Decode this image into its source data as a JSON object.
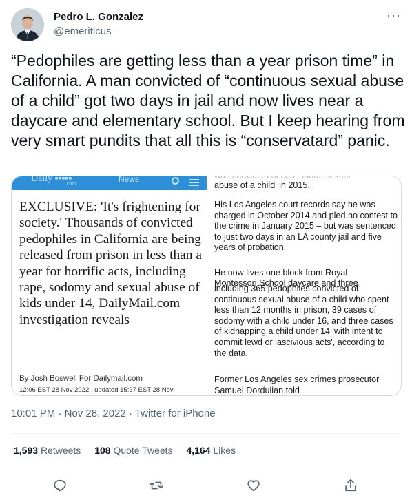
{
  "author": {
    "name": "Pedro L. Gonzalez",
    "handle": "@emeriticus",
    "more": "···"
  },
  "tweet": {
    "text": "“Pedophiles are getting less than a year prison time” in California. A man convicted of “continuous sexual abuse of a child” got two days in jail and now lives near a daycare and elementary school. But I keep hearing from very smart pundits that all this is “conservatard” panic."
  },
  "media": {
    "site_logo": "Daily ▪▪▪▪▪",
    "site_domain": ".com",
    "site_news": "News",
    "headline": "EXCLUSIVE: 'It's frightening for society.' Thousands of convicted pedophiles in California are being released from prison in less than a year for horrific acts, including rape, sodomy and sexual abuse of kids under 14, DailyMail.com investigation reveals",
    "byline": "By Josh Boswell For Dailymail.com",
    "dateline": "12:06 EST 28 Nov 2022 , updated 15:37 EST 28 Nov",
    "fragment_top": "abuse of a child' in 2015.",
    "para1": "His Los Angeles court records say he was charged in October 2014 and pled no contest to the crime in January 2015 – but was sentenced to just two days in an LA county jail and five years of probation.",
    "para2": "He now lives one block from Royal",
    "para2_overlap": "Montessori School daycare and three",
    "para3": "including 365 pedophiles convicted of continuous sexual abuse of a child who spent less than 12 months in prison, 39 cases of sodomy with a child under 16, and three cases of kidnapping a child under 14 'with intent to commit lewd or lascivious acts', according to the data.",
    "para4": "Former Los Angeles sex crimes prosecutor Samuel Dordulian told"
  },
  "meta": {
    "time": "10:01 PM",
    "sep": " · ",
    "date": "Nov 28, 2022",
    "source": "Twitter for iPhone"
  },
  "stats": {
    "retweets_count": "1,593",
    "retweets_label": "Retweets",
    "quotes_count": "108",
    "quotes_label": "Quote Tweets",
    "likes_count": "4,164",
    "likes_label": "Likes"
  },
  "icons": {
    "reply": "reply-icon",
    "retweet": "retweet-icon",
    "like": "like-icon",
    "share": "share-icon"
  },
  "colors": {
    "text": "#0f1419",
    "secondary": "#536471",
    "divider": "#eff3f4",
    "dailymail_blue": "#2d8fd8"
  }
}
